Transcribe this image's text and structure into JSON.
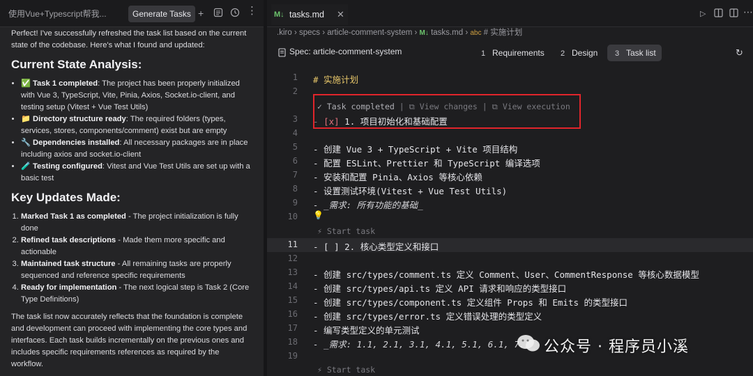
{
  "left_tabs": {
    "tab1": "使用Vue+Typescript帮我...",
    "tab2": "Generate Tasks"
  },
  "chat": {
    "intro": "Perfect! I've successfully refreshed the task list based on the current state of the codebase. Here's what I found and updated:",
    "h1": "Current State Analysis:",
    "state_items": [
      {
        "icon": "✅",
        "bold": "Task 1 completed",
        "text": ": The project has been properly initialized with Vue 3, TypeScript, Vite, Pinia, Axios, Socket.io-client, and testing setup (Vitest + Vue Test Utils)"
      },
      {
        "icon": "📁",
        "bold": "Directory structure ready",
        "text": ": The required folders (types, services, stores, components/comment) exist but are empty"
      },
      {
        "icon": "🔧",
        "bold": "Dependencies installed",
        "text": ": All necessary packages are in place including axios and socket.io-client"
      },
      {
        "icon": "🧪",
        "bold": "Testing configured",
        "text": ": Vitest and Vue Test Utils are set up with a basic test"
      }
    ],
    "h2": "Key Updates Made:",
    "update_items": [
      {
        "bold": "Marked Task 1 as completed",
        "text": " - The project initialization is fully done"
      },
      {
        "bold": "Refined task descriptions",
        "text": " - Made them more specific and actionable"
      },
      {
        "bold": "Maintained task structure",
        "text": " - All remaining tasks are properly sequenced and reference specific requirements"
      },
      {
        "bold": "Ready for implementation",
        "text": " - The next logical step is Task 2 (Core Type Definitions)"
      }
    ],
    "outro": "The task list now accurately reflects that the foundation is complete and development can proceed with implementing the core types and interfaces. Each task builds incrementally on the previous ones and includes specific requirements references as required by the workflow."
  },
  "file_tab": {
    "name": "tasks.md"
  },
  "breadcrumb": [
    ".kiro",
    "specs",
    "article-comment-system",
    "tasks.md",
    "# 实施计划"
  ],
  "spec": {
    "label": "Spec: article-comment-system",
    "tabs": [
      {
        "num": "1",
        "label": "Requirements"
      },
      {
        "num": "2",
        "label": "Design"
      },
      {
        "num": "3",
        "label": "Task list"
      }
    ]
  },
  "editor": {
    "lines": [
      {
        "n": "1",
        "text": "# 实施计划"
      },
      {
        "n": "2",
        "text": ""
      },
      {
        "n": "3",
        "text": "- [x] 1. 项目初始化和基础配置"
      },
      {
        "n": "4",
        "text": ""
      },
      {
        "n": "5",
        "text": "  - 创建 Vue 3 + TypeScript + Vite 项目结构"
      },
      {
        "n": "6",
        "text": "  - 配置 ESLint、Prettier 和 TypeScript 编译选项"
      },
      {
        "n": "7",
        "text": "  - 安装和配置 Pinia、Axios 等核心依赖"
      },
      {
        "n": "8",
        "text": "  - 设置测试环境(Vitest + Vue Test Utils)"
      },
      {
        "n": "9",
        "text": "  - _需求: 所有功能的基础_"
      },
      {
        "n": "10",
        "text": ""
      },
      {
        "n": "11",
        "text": "- [ ] 2. 核心类型定义和接口"
      },
      {
        "n": "12",
        "text": ""
      },
      {
        "n": "13",
        "text": "  - 创建 src/types/comment.ts 定义 Comment、User、CommentResponse 等核心数据模型"
      },
      {
        "n": "14",
        "text": "  - 创建 src/types/api.ts 定义 API 请求和响应的类型接口"
      },
      {
        "n": "15",
        "text": "  - 创建 src/types/component.ts 定义组件 Props 和 Emits 的类型接口"
      },
      {
        "n": "16",
        "text": "  - 创建 src/types/error.ts 定义错误处理的类型定义"
      },
      {
        "n": "17",
        "text": "  - 编写类型定义的单元测试"
      },
      {
        "n": "18",
        "text": "  - _需求: 1.1, 2.1, 3.1, 4.1, 5.1, 6.1, 7.1_"
      },
      {
        "n": "19",
        "text": ""
      }
    ],
    "lens_completed": "Task completed",
    "lens_view_changes": "View changes",
    "lens_view_execution": "View execution",
    "lens_start_task": "Start task"
  },
  "watermark": "公众号 · 程序员小溪"
}
